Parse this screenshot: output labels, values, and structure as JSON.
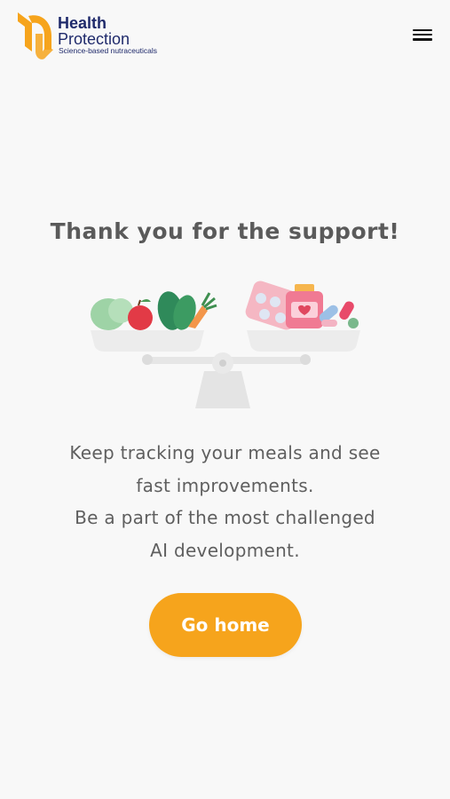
{
  "header": {
    "brand_line1": "Health",
    "brand_line2": "Protection",
    "tagline": "Science-based nutraceuticals",
    "menu_icon": "hamburger-menu-icon"
  },
  "main": {
    "title": "Thank you for the support!",
    "illustration_icon": "balance-scale-food-vs-pills-illustration",
    "message_lines": [
      "Keep tracking your meals and see",
      "fast improvements.",
      "Be a part of the most challenged",
      "AI development."
    ],
    "cta_label": "Go home"
  },
  "colors": {
    "brand_orange": "#f6a41c",
    "brand_navy": "#1f2a6b",
    "text_gray": "#5f5f5f",
    "background": "#f8f8f8"
  }
}
